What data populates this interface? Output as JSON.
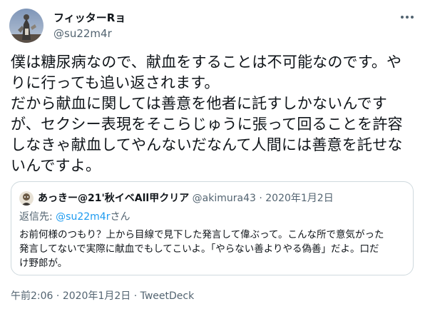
{
  "author": {
    "display_name": "フィッターRョ",
    "handle": "@su22m4r",
    "avatar_icon": "avatar-figure-icon"
  },
  "more_icon": "more-options-icon",
  "tweet": {
    "lines": [
      "僕は糖尿病なので、献血をすることは不可能なのです。や",
      "りに行っても追い返されます。",
      "だから献血に関しては善意を他者に託すしかないんです",
      "が、セクシー表現をそこらじゅうに張って回ることを許容",
      "しなきゃ献血してやんないだなんて人間には善意を託せな",
      "いんですよ。"
    ]
  },
  "quote": {
    "display_name": "あっきー@21'秋イベAll甲クリア",
    "handle": "@akimura43",
    "separator": " · ",
    "date": "2020年1月2日",
    "reply_prefix": "返信先: ",
    "reply_handle": "@su22m4r",
    "reply_suffix": "さん",
    "lines": [
      "お前何様のつもり？上から目線で見下した発言して偉ぶって。こんな所で意気がった",
      "発言してないで実際に献血でもしてこいよ。「やらない善よりやる偽善」だよ。口だ",
      "け野郎が。"
    ]
  },
  "footer": {
    "time": "午前2:06",
    "separator": " · ",
    "date": "2020年1月2日",
    "separator2": " · ",
    "source": "TweetDeck"
  }
}
